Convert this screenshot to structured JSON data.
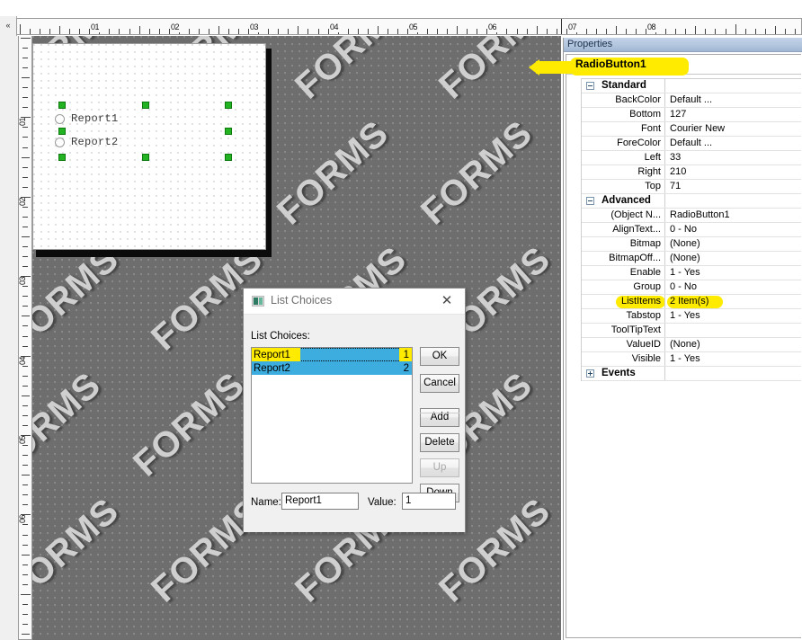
{
  "rulers": {
    "corner_glyph": "«",
    "horizontal_labels": [
      "01",
      "02",
      "03",
      "04",
      "05",
      "06",
      "07",
      "08"
    ],
    "vertical_labels": [
      "01",
      "02",
      "03",
      "04",
      "05",
      "06"
    ]
  },
  "designer": {
    "watermark_text": "FORMS",
    "form": {
      "radio_buttons": [
        {
          "label": "Report1"
        },
        {
          "label": "Report2"
        }
      ]
    }
  },
  "properties": {
    "panel_title": "Properties",
    "object_name": "RadioButton1",
    "groups": [
      {
        "name": "Standard",
        "expanded": true,
        "rows": [
          {
            "name": "BackColor",
            "value": "Default ..."
          },
          {
            "name": "Bottom",
            "value": "127"
          },
          {
            "name": "Font",
            "value": "Courier New"
          },
          {
            "name": "ForeColor",
            "value": "Default ..."
          },
          {
            "name": "Left",
            "value": "33"
          },
          {
            "name": "Right",
            "value": "210"
          },
          {
            "name": "Top",
            "value": "71"
          }
        ]
      },
      {
        "name": "Advanced",
        "expanded": true,
        "rows": [
          {
            "name": "(Object N...",
            "value": "RadioButton1"
          },
          {
            "name": "AlignText...",
            "value": "0 - No"
          },
          {
            "name": "Bitmap",
            "value": "(None)"
          },
          {
            "name": "BitmapOff...",
            "value": "(None)"
          },
          {
            "name": "Enable",
            "value": "1 - Yes"
          },
          {
            "name": "Group",
            "value": "0 - No"
          },
          {
            "name": "ListItems",
            "value": "2 Item(s)",
            "highlighted": true
          },
          {
            "name": "Tabstop",
            "value": "1 - Yes"
          },
          {
            "name": "ToolTipText",
            "value": ""
          },
          {
            "name": "ValueID",
            "value": "(None)"
          },
          {
            "name": "Visible",
            "value": "1 - Yes"
          }
        ]
      },
      {
        "name": "Events",
        "expanded": false,
        "rows": []
      }
    ]
  },
  "dialog": {
    "title": "List Choices",
    "close_label": "✕",
    "list_label": "List Choices:",
    "items": [
      {
        "name": "Report1",
        "value": "1",
        "selected": true,
        "focused": true,
        "highlighted": true
      },
      {
        "name": "Report2",
        "value": "2",
        "selected": true,
        "focused": false,
        "highlighted": false
      }
    ],
    "buttons": [
      {
        "label": "OK",
        "enabled": true
      },
      {
        "label": "Cancel",
        "enabled": true
      },
      {
        "label": "Add",
        "enabled": true
      },
      {
        "label": "Delete",
        "enabled": true
      },
      {
        "label": "Up",
        "enabled": false
      },
      {
        "label": "Down",
        "enabled": true
      }
    ],
    "name_label": "Name:",
    "name_value": "Report1",
    "value_label": "Value:",
    "value_value": "1"
  },
  "colors": {
    "highlight": "#ffeb00",
    "selection": "#3dade0",
    "handle": "#22b222",
    "canvas": "#6e6e6e",
    "panel_title": "#b3c6de"
  }
}
